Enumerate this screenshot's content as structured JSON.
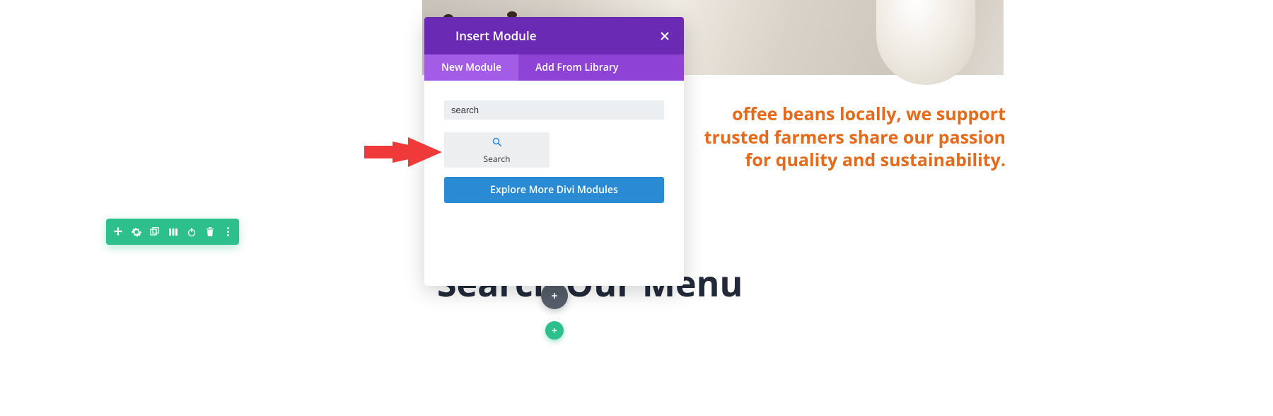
{
  "hero_text": "offee beans locally, we support trusted farmers share our passion for quality and sustainability.",
  "modal": {
    "title": "Insert Module",
    "tabs": [
      {
        "label": "New Module",
        "active": true
      },
      {
        "label": "Add From Library",
        "active": false
      }
    ],
    "search_value": "search",
    "modules": [
      {
        "icon": "search-icon",
        "label": "Search"
      }
    ],
    "explore_label": "Explore More Divi Modules"
  },
  "behind_heading": "Search Our Menu",
  "toolbar_icons": [
    "move-icon",
    "settings-icon",
    "duplicate-icon",
    "columns-icon",
    "power-icon",
    "trash-icon",
    "more-icon"
  ],
  "add_row_button": "+",
  "add_section_button": "+",
  "colors": {
    "purple_dark": "#6b2ab3",
    "purple_mid": "#8e43d6",
    "purple_light": "#a25ce6",
    "teal": "#2dc08d",
    "blue": "#2a8ad4",
    "orange": "#e56a1b"
  }
}
